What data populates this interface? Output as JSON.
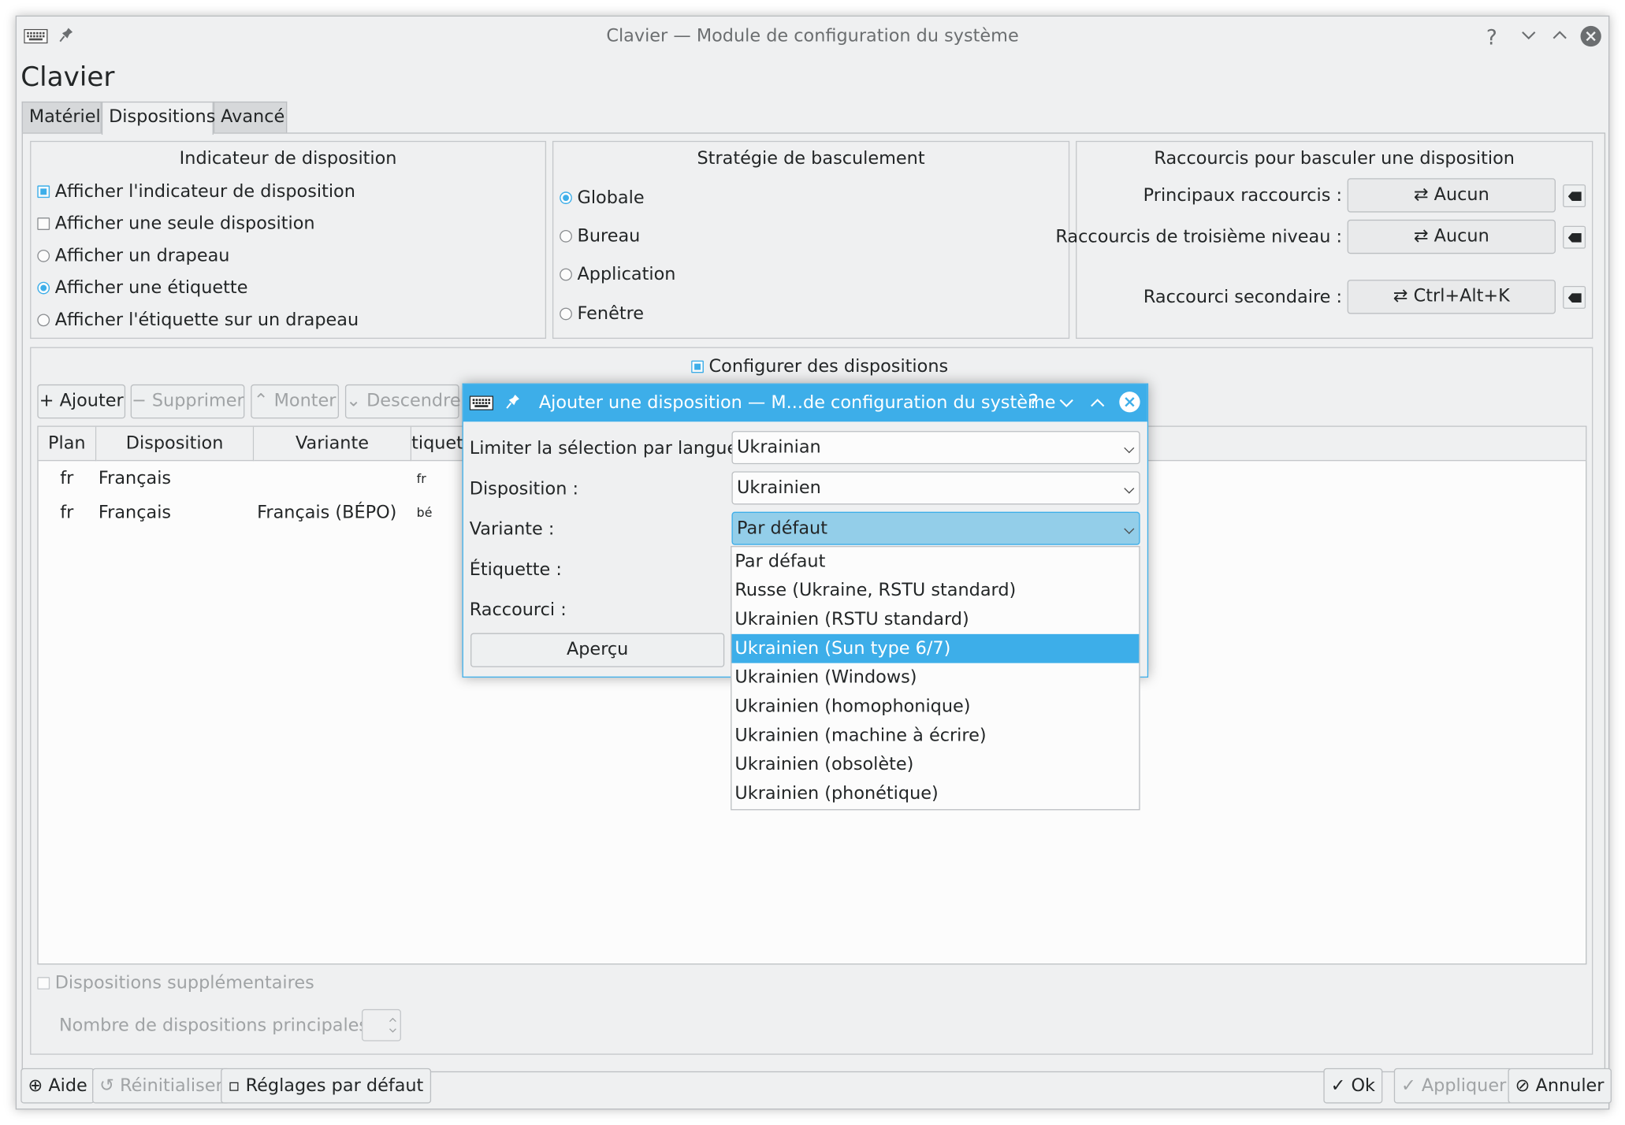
{
  "window": {
    "title": "Clavier — Module de configuration du système",
    "heading": "Clavier"
  },
  "tabs": [
    "Matériel",
    "Dispositions",
    "Avancé"
  ],
  "indicator_group": {
    "title": "Indicateur de disposition",
    "options": [
      {
        "label": "Afficher l'indicateur de disposition",
        "type": "checkbox",
        "checked": true
      },
      {
        "label": "Afficher une seule disposition",
        "type": "checkbox",
        "checked": false
      },
      {
        "label": "Afficher un drapeau",
        "type": "radio",
        "checked": false
      },
      {
        "label": "Afficher une étiquette",
        "type": "radio",
        "checked": true
      },
      {
        "label": "Afficher l'étiquette sur un drapeau",
        "type": "radio",
        "checked": false
      }
    ]
  },
  "strategy_group": {
    "title": "Stratégie de basculement",
    "options": [
      {
        "label": "Globale",
        "checked": true
      },
      {
        "label": "Bureau",
        "checked": false
      },
      {
        "label": "Application",
        "checked": false
      },
      {
        "label": "Fenêtre",
        "checked": false
      }
    ]
  },
  "shortcuts_group": {
    "title": "Raccourcis pour basculer une disposition",
    "rows": [
      {
        "label": "Principaux raccourcis :",
        "value": "Aucun"
      },
      {
        "label": "Raccourcis de troisième niveau :",
        "value": "Aucun"
      },
      {
        "label": "Raccourci secondaire :",
        "value": "Ctrl+Alt+K"
      }
    ]
  },
  "layouts": {
    "configure_label": "Configurer des dispositions",
    "toolbar": {
      "add": "Ajouter",
      "remove": "Supprimer",
      "up": "Monter",
      "down": "Descendre"
    },
    "columns": [
      "Plan",
      "Disposition",
      "Variante",
      "tiquett"
    ],
    "rows": [
      {
        "plan": "fr",
        "layout": "Français",
        "variant": "",
        "label": "fr"
      },
      {
        "plan": "fr",
        "layout": "Français",
        "variant": "Français (BÉPO)",
        "label": "bé"
      }
    ],
    "extra_label": "Dispositions supplémentaires",
    "main_count_label": "Nombre de dispositions principales :"
  },
  "footer": {
    "help": "Aide",
    "reset": "Réinitialiser",
    "defaults": "Réglages par défaut",
    "ok": "Ok",
    "apply": "Appliquer",
    "cancel": "Annuler"
  },
  "dialog": {
    "title": "Ajouter une disposition — M...de configuration du système",
    "language_label": "Limiter la sélection par langue :",
    "language_value": "Ukrainian",
    "layout_label": "Disposition :",
    "layout_value": "Ukrainien",
    "variant_label": "Variante :",
    "variant_value": "Par défaut",
    "tag_label": "Étiquette :",
    "shortcut_label": "Raccourci :",
    "preview_button": "Aperçu",
    "variant_options": [
      "Par défaut",
      "Russe (Ukraine, RSTU standard)",
      "Ukrainien (RSTU standard)",
      "Ukrainien (Sun type 6/7)",
      "Ukrainien (Windows)",
      "Ukrainien (homophonique)",
      "Ukrainien (machine à écrire)",
      "Ukrainien (obsolète)",
      "Ukrainien (phonétique)"
    ],
    "highlighted_option": "Ukrainien (Sun type 6/7)"
  },
  "colors": {
    "accent": "#3daee9",
    "window_bg": "#eff0f1",
    "view_bg": "#fcfcfc",
    "text": "#232627"
  }
}
